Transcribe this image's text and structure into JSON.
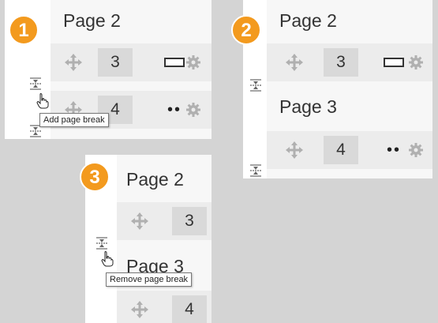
{
  "colors": {
    "badge": "#f39a1e",
    "icon_grey": "#b0b0b0",
    "row_bg": "#ececec"
  },
  "panel1": {
    "badge": "1",
    "page_title": "Page 2",
    "rows": [
      {
        "number": "3",
        "type_icon": "box-icon"
      },
      {
        "number": "4",
        "type_icon": "dots-icon",
        "dots": "••"
      }
    ],
    "tooltip": "Add page break"
  },
  "panel2": {
    "badge": "2",
    "page_titles": [
      "Page 2",
      "Page 3"
    ],
    "rows": [
      {
        "number": "3",
        "type_icon": "box-icon"
      },
      {
        "number": "4",
        "type_icon": "dots-icon",
        "dots": "••"
      }
    ]
  },
  "panel3": {
    "badge": "3",
    "page_titles": [
      "Page 2",
      "Page 3"
    ],
    "rows": [
      {
        "number": "3"
      },
      {
        "number": "4"
      }
    ],
    "tooltip": "Remove page break"
  }
}
